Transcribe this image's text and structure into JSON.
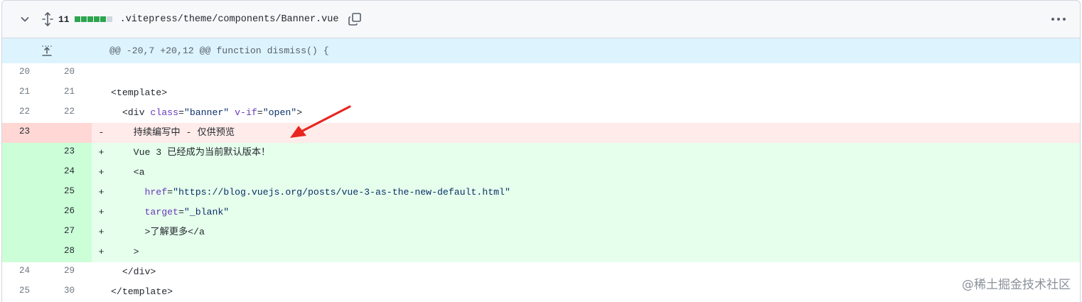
{
  "header": {
    "changes": "11",
    "diffstat": [
      "add",
      "add",
      "add",
      "add",
      "add",
      "neutral"
    ],
    "file_path": ".vitepress/theme/components/Banner.vue"
  },
  "hunk": {
    "header": "@@ -20,7 +20,12 @@ function dismiss() {"
  },
  "lines": [
    {
      "type": "ctx",
      "old": "20",
      "new": "20",
      "sign": "",
      "indent": "",
      "segments": []
    },
    {
      "type": "ctx",
      "old": "21",
      "new": "21",
      "sign": "",
      "indent": "",
      "segments": [
        {
          "t": "tag",
          "v": "<template>"
        }
      ]
    },
    {
      "type": "ctx",
      "old": "22",
      "new": "22",
      "sign": "",
      "indent": "  ",
      "segments": [
        {
          "t": "tag",
          "v": "<div "
        },
        {
          "t": "attr",
          "v": "class"
        },
        {
          "t": "tag",
          "v": "="
        },
        {
          "t": "str",
          "v": "\"banner\""
        },
        {
          "t": "tag",
          "v": " "
        },
        {
          "t": "attr",
          "v": "v-if"
        },
        {
          "t": "tag",
          "v": "="
        },
        {
          "t": "str",
          "v": "\"open\""
        },
        {
          "t": "tag",
          "v": ">"
        }
      ]
    },
    {
      "type": "del",
      "old": "23",
      "new": "",
      "sign": "-",
      "indent": "    ",
      "segments": [
        {
          "t": "tag",
          "v": "持续编写中 - 仅供预览"
        }
      ]
    },
    {
      "type": "add",
      "old": "",
      "new": "23",
      "sign": "+",
      "indent": "    ",
      "segments": [
        {
          "t": "tag",
          "v": "Vue 3 已经成为当前默认版本！"
        }
      ]
    },
    {
      "type": "add",
      "old": "",
      "new": "24",
      "sign": "+",
      "indent": "    ",
      "segments": [
        {
          "t": "tag",
          "v": "<a"
        }
      ]
    },
    {
      "type": "add",
      "old": "",
      "new": "25",
      "sign": "+",
      "indent": "      ",
      "segments": [
        {
          "t": "attr",
          "v": "href"
        },
        {
          "t": "tag",
          "v": "="
        },
        {
          "t": "str",
          "v": "\"https://blog.vuejs.org/posts/vue-3-as-the-new-default.html\""
        }
      ]
    },
    {
      "type": "add",
      "old": "",
      "new": "26",
      "sign": "+",
      "indent": "      ",
      "segments": [
        {
          "t": "attr",
          "v": "target"
        },
        {
          "t": "tag",
          "v": "="
        },
        {
          "t": "str",
          "v": "\"_blank\""
        }
      ]
    },
    {
      "type": "add",
      "old": "",
      "new": "27",
      "sign": "+",
      "indent": "      ",
      "segments": [
        {
          "t": "tag",
          "v": ">了解更多</a"
        }
      ]
    },
    {
      "type": "add",
      "old": "",
      "new": "28",
      "sign": "+",
      "indent": "    ",
      "segments": [
        {
          "t": "tag",
          "v": ">"
        }
      ]
    },
    {
      "type": "ctx",
      "old": "24",
      "new": "29",
      "sign": "",
      "indent": "  ",
      "segments": [
        {
          "t": "tag",
          "v": "</div>"
        }
      ]
    },
    {
      "type": "ctx",
      "old": "25",
      "new": "30",
      "sign": "",
      "indent": "",
      "segments": [
        {
          "t": "tag",
          "v": "</template>"
        }
      ]
    }
  ],
  "watermark": "@稀土掘金技术社区",
  "colors": {
    "add_gutter": "#ccffd8",
    "add_bg": "#e6ffec",
    "del_gutter": "#ffd7d5",
    "del_bg": "#ffebe9",
    "hunk_bg": "#ddf4ff",
    "annotation_arrow": "#e8251f"
  },
  "icons": [
    "chevron-down-icon",
    "unfold-icon",
    "copy-icon",
    "kebab-horizontal-icon",
    "fold-up-icon"
  ]
}
